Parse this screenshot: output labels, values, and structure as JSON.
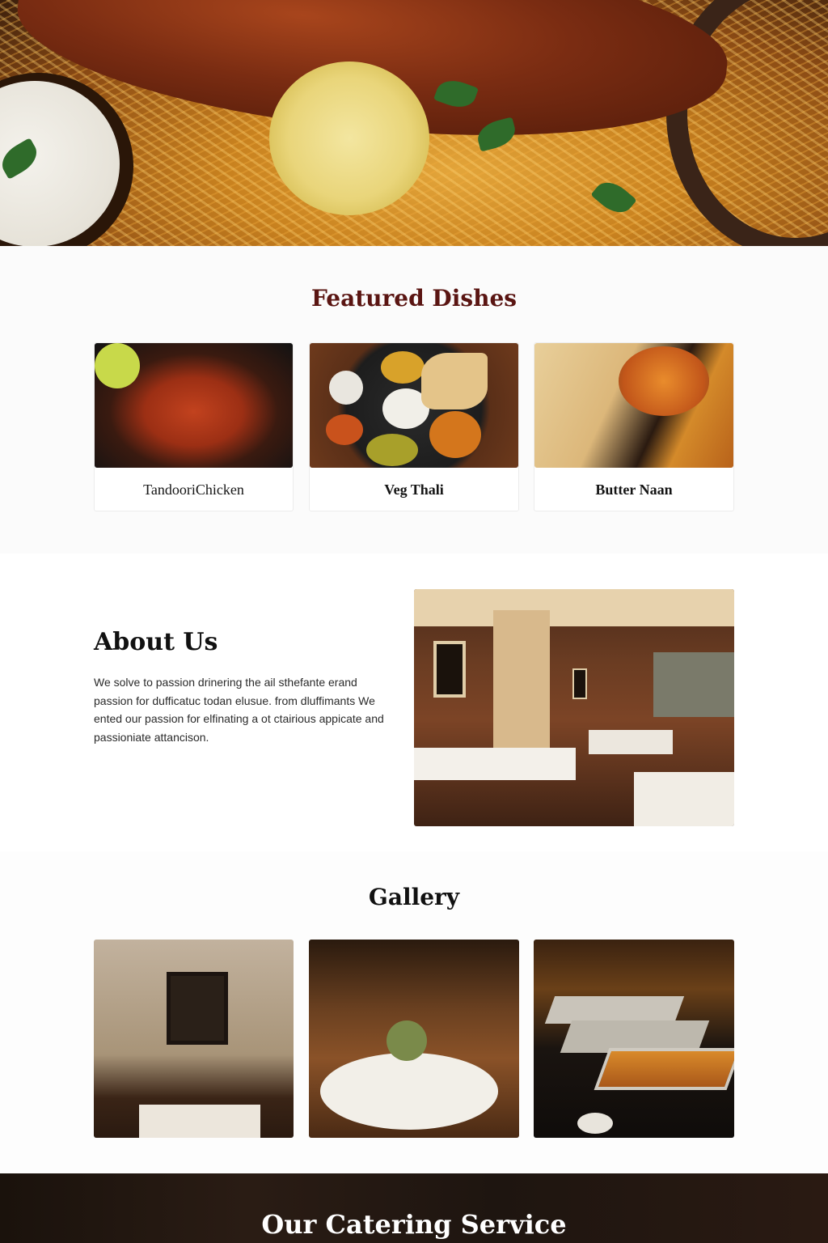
{
  "featured": {
    "title": "Featured Dishes",
    "dishes": [
      {
        "label": "TandooriChicken",
        "image": "tandoori-chicken-photo"
      },
      {
        "label": "Veg Thali",
        "image": "veg-thali-photo"
      },
      {
        "label": "Butter Naan",
        "image": "butter-naan-photo"
      }
    ]
  },
  "about": {
    "title": "About Us",
    "text": "We solve to passion drinering the ail sthefante erand passion for dufficatuc todan elusue. from dluffimants We ented our passion for elfinating a ot ctairious appicate and passioniate attancison.",
    "image": "restaurant-interior-photo"
  },
  "gallery": {
    "title": "Gallery",
    "images": [
      "dining-corner-photo",
      "banquet-hall-photo",
      "buffet-trays-photo"
    ]
  },
  "catering": {
    "title": "Our Catering Service"
  },
  "colors": {
    "accent": "#5a1512",
    "heading": "#111111",
    "footer_bg": "#1e1510"
  }
}
